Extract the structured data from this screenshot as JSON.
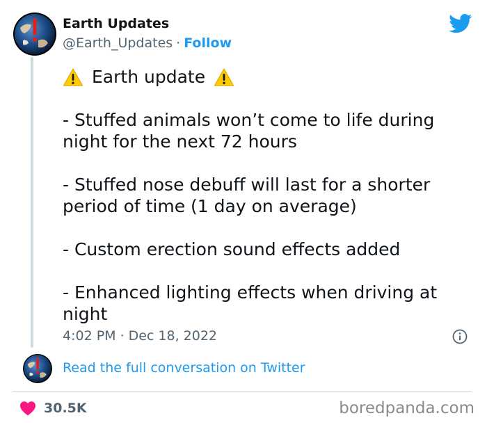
{
  "author": {
    "name": "Earth Updates",
    "handle": "@Earth_Updates",
    "separator": "·",
    "follow_label": "Follow",
    "avatar_icon": "earth-warning-avatar"
  },
  "tweet": {
    "headline": "Earth update",
    "headline_icon": "warning-icon",
    "paragraphs": [
      "- Stuffed animals won’t come to life during night for the next 72 hours",
      "- Stuffed nose debuff will last for a shorter period of time (1 day on average)",
      "- Custom erection sound effects added",
      "- Enhanced lighting effects when driving at night"
    ],
    "time": "4:02 PM",
    "date_separator": "·",
    "date": "Dec 18, 2022"
  },
  "conversation_link": "Read the full conversation on Twitter",
  "engagement": {
    "likes": "30.5K",
    "like_icon": "heart-icon"
  },
  "watermark": "boredpanda.com",
  "colors": {
    "accent": "#1d9bf0",
    "heart": "#f91880",
    "secondary_text": "#536471",
    "warning": "#ffcc00"
  }
}
